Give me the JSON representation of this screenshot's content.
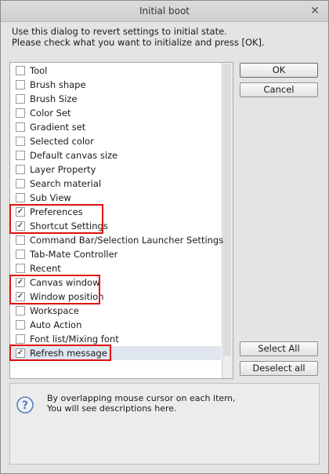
{
  "window": {
    "title": "Initial boot",
    "close_symbol": "✕"
  },
  "instructions": {
    "line1": "Use this dialog to revert settings to initial state.",
    "line2": " Please check what you want to initialize and press [OK]."
  },
  "items": [
    {
      "label": "Tool",
      "checked": false
    },
    {
      "label": "Brush shape",
      "checked": false
    },
    {
      "label": "Brush Size",
      "checked": false
    },
    {
      "label": "Color Set",
      "checked": false
    },
    {
      "label": "Gradient set",
      "checked": false
    },
    {
      "label": "Selected color",
      "checked": false
    },
    {
      "label": "Default canvas size",
      "checked": false
    },
    {
      "label": "Layer Property",
      "checked": false
    },
    {
      "label": "Search material",
      "checked": false
    },
    {
      "label": "Sub View",
      "checked": false
    },
    {
      "label": "Preferences",
      "checked": true
    },
    {
      "label": "Shortcut Settings",
      "checked": true
    },
    {
      "label": "Command Bar/Selection Launcher Settings",
      "checked": false
    },
    {
      "label": "Tab-Mate Controller",
      "checked": false
    },
    {
      "label": "Recent",
      "checked": false
    },
    {
      "label": "Canvas window",
      "checked": true
    },
    {
      "label": "Window position",
      "checked": true
    },
    {
      "label": "Workspace",
      "checked": false
    },
    {
      "label": "Auto Action",
      "checked": false
    },
    {
      "label": "Font list/Mixing font",
      "checked": false
    },
    {
      "label": "Refresh message",
      "checked": true,
      "selected": true
    }
  ],
  "buttons": {
    "ok": "OK",
    "cancel": "Cancel",
    "select_all": "Select All",
    "deselect_all": "Deselect all"
  },
  "description": {
    "line1": "By overlapping mouse cursor on each item,",
    "line2": "You will see descriptions here."
  },
  "colors": {
    "highlight": "#e01010",
    "icon": "#5a7fb0"
  }
}
